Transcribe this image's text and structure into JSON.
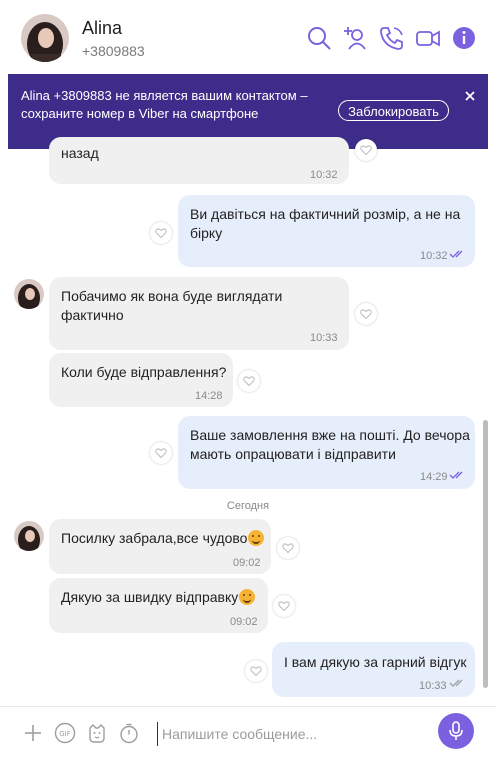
{
  "header": {
    "name": "Alina",
    "phone": "+3809883"
  },
  "banner": {
    "text": "Alina +3809883           не является вашим контактом – сохраните номер в Viber на смартфоне",
    "block_label": "Заблокировать"
  },
  "messages": [
    {
      "text": "назад",
      "time": "10:32"
    },
    {
      "text_l1": "Ви давіться на фактичний розмір, а не на",
      "text_l2": "бірку",
      "time": "10:32"
    },
    {
      "text_l1": "Побачимо як вона буде виглядати",
      "text_l2": "фактично",
      "time": "10:33"
    },
    {
      "text": "Коли буде відправлення?",
      "time": "14:28"
    },
    {
      "text_l1": "Ваше замовлення вже на пошті. До вечора",
      "text_l2": "мають опрацювати і відправити",
      "time": "14:29"
    },
    {
      "text": "Посилку забрала,все чудово",
      "time": "09:02"
    },
    {
      "text": "Дякую за швидку відправку",
      "time": "09:02"
    },
    {
      "text": "І вам дякую за гарний відгук",
      "time": "10:33"
    }
  ],
  "date_separator": "Сегодня",
  "composer": {
    "placeholder": "Напишите сообщение..."
  },
  "colors": {
    "accent": "#7b61e0",
    "banner": "#3e2c8a",
    "incoming_bubble": "#f0f0f0",
    "outgoing_bubble": "#e7eefb"
  },
  "icons": [
    "search-icon",
    "add-contact-icon",
    "call-icon",
    "video-icon",
    "info-icon",
    "close-icon",
    "like-icon",
    "read-check-icon",
    "plus-icon",
    "gif-icon",
    "sticker-icon",
    "timer-icon",
    "microphone-icon"
  ]
}
